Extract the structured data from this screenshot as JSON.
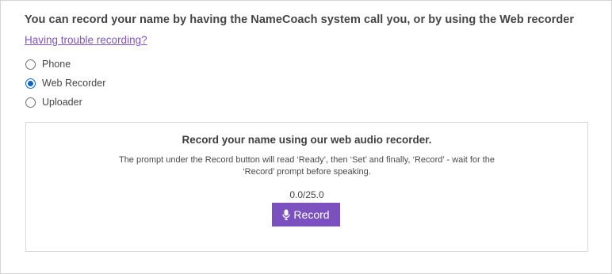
{
  "heading": "You can record your name by having the NameCoach system call you, or by using the Web recorder",
  "trouble_link": "Having trouble recording?",
  "options": [
    {
      "label": "Phone",
      "selected": false
    },
    {
      "label": "Web Recorder",
      "selected": true
    },
    {
      "label": "Uploader",
      "selected": false
    }
  ],
  "recorder": {
    "title": "Record your name using our web audio recorder.",
    "description": "The prompt under the Record button will read ‘Ready’, then ‘Set’ and finally, ‘Record’ - wait for the ‘Record’ prompt before speaking.",
    "counter": "0.0/25.0",
    "button_label": "Record",
    "button_icon": "microphone-icon"
  },
  "colors": {
    "accent": "#7b51bf",
    "link": "#7f54c0",
    "radio_selected": "#0a66c8"
  }
}
